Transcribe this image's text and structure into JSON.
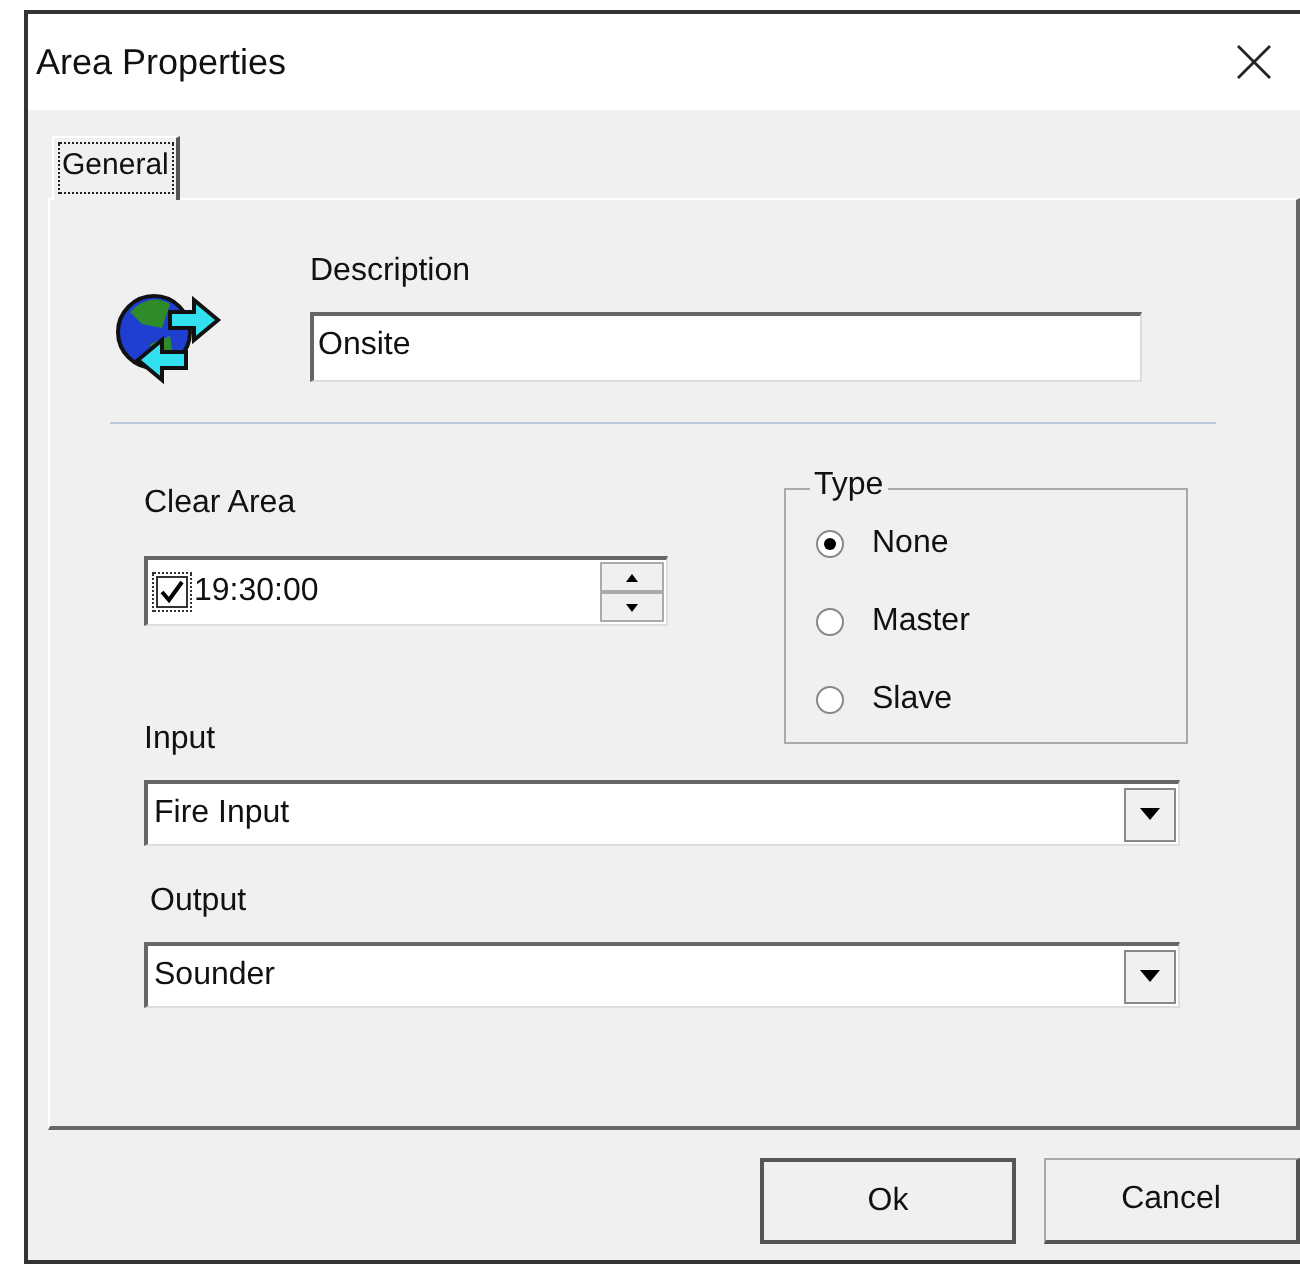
{
  "window": {
    "title": "Area Properties"
  },
  "tabs": [
    {
      "label": "General",
      "selected": true
    }
  ],
  "description": {
    "label": "Description",
    "value": "Onsite"
  },
  "clear_area": {
    "label": "Clear Area",
    "checked": true,
    "value": "19:30:00"
  },
  "type": {
    "label": "Type",
    "options": [
      {
        "label": "None",
        "selected": true
      },
      {
        "label": "Master",
        "selected": false
      },
      {
        "label": "Slave",
        "selected": false
      }
    ]
  },
  "input": {
    "label": "Input",
    "value": "Fire Input"
  },
  "output": {
    "label": "Output",
    "value": "Sounder"
  },
  "buttons": [
    "Ok",
    "Cancel"
  ]
}
